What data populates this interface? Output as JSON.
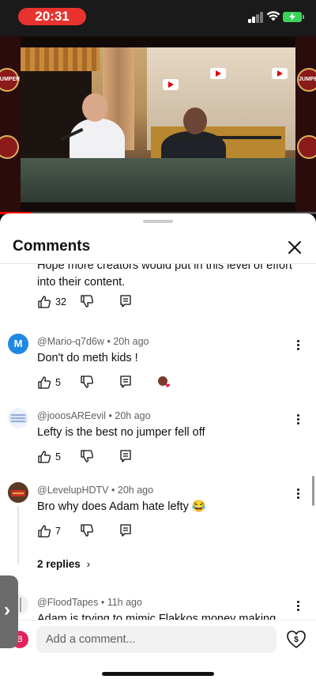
{
  "status_bar": {
    "time": "20:31"
  },
  "video": {
    "progress_fraction": 0.1,
    "left_badge_text": "JUMPER",
    "right_badge_text": "JUMPER"
  },
  "comments_panel": {
    "title": "Comments",
    "close_icon": "close-icon",
    "comments": [
      {
        "text": "Hope more creators would put in this level of effort into their content.",
        "likes": "32"
      },
      {
        "avatar_letter": "M",
        "avatar_color": "#1e88e5",
        "author": "@Mario-q7d6w",
        "time": "20h ago",
        "text": "Don't do meth kids !",
        "likes": "5",
        "creator_heart": true
      },
      {
        "author": "@jooosAREevil",
        "time": "20h ago",
        "text": "Lefty is the best no jumper fell off",
        "likes": "5"
      },
      {
        "author": "@LevelupHDTV",
        "time": "20h ago",
        "text": "Bro why does Adam hate lefty 😂",
        "likes": "7",
        "replies_label": "2 replies"
      },
      {
        "author": "@FloodTapes",
        "time": "11h ago",
        "text": "Adam is trying to mimic Flakkos money making"
      }
    ]
  },
  "add_comment": {
    "avatar_letter": "B",
    "placeholder": "Add a comment...",
    "super_thanks_icon": "super-thanks-icon"
  },
  "meta_separator": "•"
}
